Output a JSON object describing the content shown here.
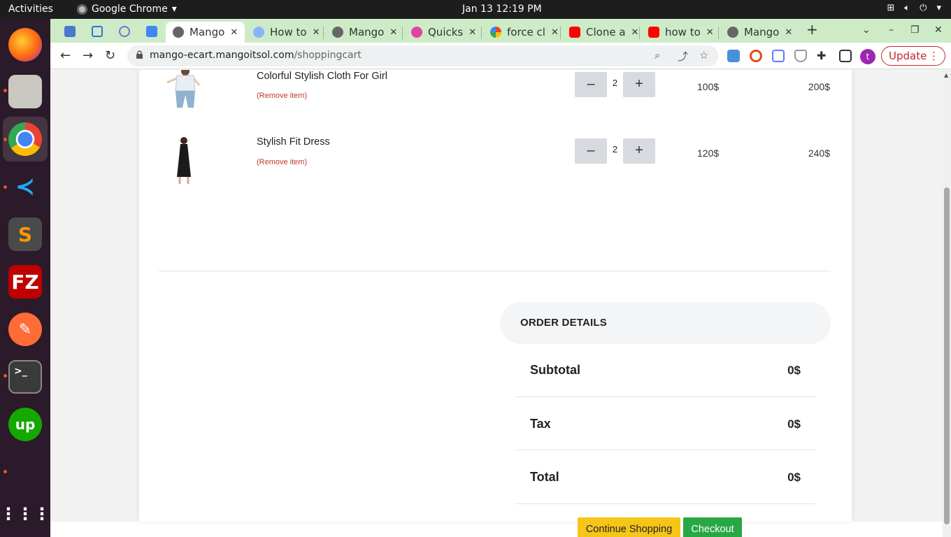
{
  "system": {
    "activities": "Activities",
    "app_name": "Google Chrome",
    "clock": "Jan 13  12:19 PM"
  },
  "browser": {
    "tabs": [
      {
        "label": "Mango",
        "active": true
      },
      {
        "label": "How to"
      },
      {
        "label": "Mango"
      },
      {
        "label": "Quicks"
      },
      {
        "label": "force cl"
      },
      {
        "label": "Clone a"
      },
      {
        "label": "how to"
      },
      {
        "label": "Mango"
      }
    ],
    "url_host": "mango-ecart.mangoitsol.com",
    "url_path": "/shoppingcart",
    "profile_initial": "t",
    "update_label": "Update"
  },
  "cart": {
    "items": [
      {
        "name": "Colorful Stylish Cloth For Girl",
        "remove_label": "(Remove item)",
        "quantity": "2",
        "price": "100$",
        "total": "200$"
      },
      {
        "name": "Stylish Fit Dress",
        "remove_label": "(Remove item)",
        "quantity": "2",
        "price": "120$",
        "total": "240$"
      }
    ]
  },
  "order": {
    "heading": "ORDER DETAILS",
    "subtotal_label": "Subtotal",
    "subtotal_value": "0$",
    "tax_label": "Tax",
    "tax_value": "0$",
    "total_label": "Total",
    "total_value": "0$"
  },
  "actions": {
    "continue_label": "Continue Shopping",
    "checkout_label": "Checkout"
  },
  "colors": {
    "tabbar": "#cdebc7",
    "continue_button": "#f5c518",
    "checkout_button": "#28a745",
    "remove_link": "#c0392b"
  }
}
